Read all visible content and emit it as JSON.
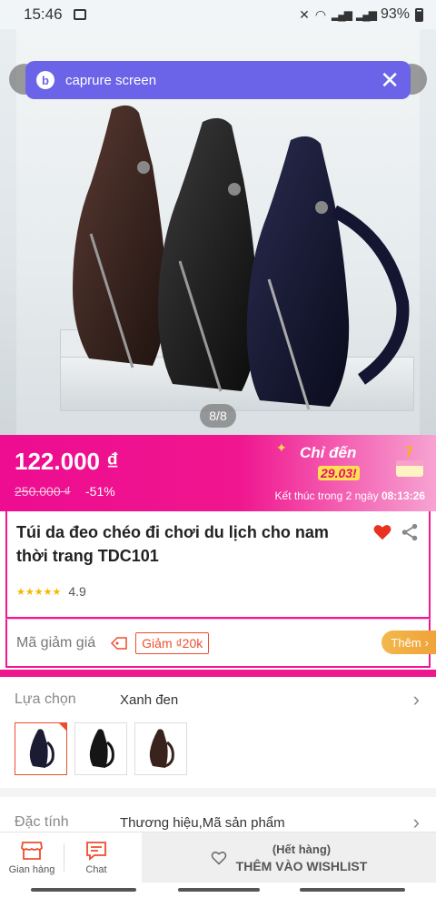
{
  "status_bar": {
    "time": "15:46",
    "battery": "93%"
  },
  "capture_bar": {
    "label": "caprure screen"
  },
  "gallery": {
    "indicator": "8/8"
  },
  "price": {
    "current": "122.000 ₫",
    "original": "250.000 ₫",
    "discount": "-51%",
    "promo_label": "Chỉ đến",
    "promo_date": "29.03!",
    "countdown_prefix": "Kết thúc trong 2 ngày",
    "countdown_time": "08:13:26"
  },
  "product": {
    "title": "Túi da đeo chéo đi chơi du lịch cho nam thời trang TDC101",
    "rating": "4.9"
  },
  "voucher": {
    "label": "Mã giảm giá",
    "chip": "Giảm ₫20k",
    "more": "Thêm"
  },
  "options": {
    "label": "Lựa chọn",
    "value": "Xanh đen",
    "variants": [
      "navy",
      "black",
      "brown"
    ]
  },
  "attributes": {
    "label": "Đặc tính",
    "value": "Thương hiệu,Mã sản phẩm"
  },
  "bottom_bar": {
    "shop": "Gian hàng",
    "chat": "Chat",
    "stock_status": "(Hết hàng)",
    "wishlist": "THÊM VÀO WISHLIST"
  },
  "colors": {
    "accent": "#f0168f",
    "orange": "#ee4d2d",
    "capture": "#6b63e8"
  }
}
